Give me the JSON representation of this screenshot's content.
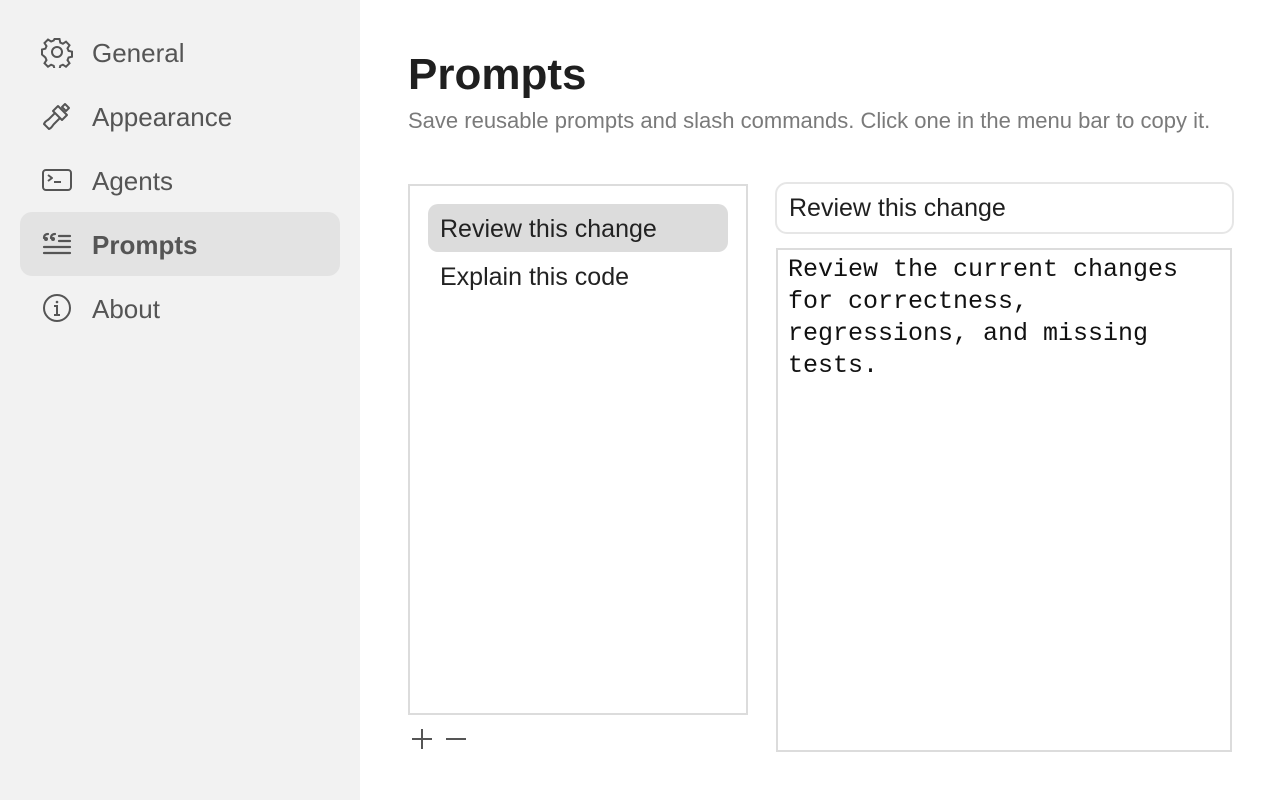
{
  "sidebar": {
    "items": [
      {
        "label": "General",
        "icon": "gear-icon"
      },
      {
        "label": "Appearance",
        "icon": "paintbrush-icon"
      },
      {
        "label": "Agents",
        "icon": "terminal-icon"
      },
      {
        "label": "Prompts",
        "icon": "quote-list-icon",
        "active": true
      },
      {
        "label": "About",
        "icon": "info-icon"
      }
    ]
  },
  "main": {
    "title": "Prompts",
    "subtitle": "Save reusable prompts and slash commands. Click one in the menu bar to copy it.",
    "prompts": [
      {
        "label": "Review this change",
        "selected": true
      },
      {
        "label": "Explain this code"
      }
    ],
    "editor": {
      "title_value": "Review this change",
      "body_value": "Review the current changes for correctness, regressions, and missing tests."
    }
  },
  "colors": {
    "sidebar_bg": "#f2f2f2",
    "active_item_bg": "#e3e3e3",
    "selected_row_bg": "#dcdcdc"
  }
}
